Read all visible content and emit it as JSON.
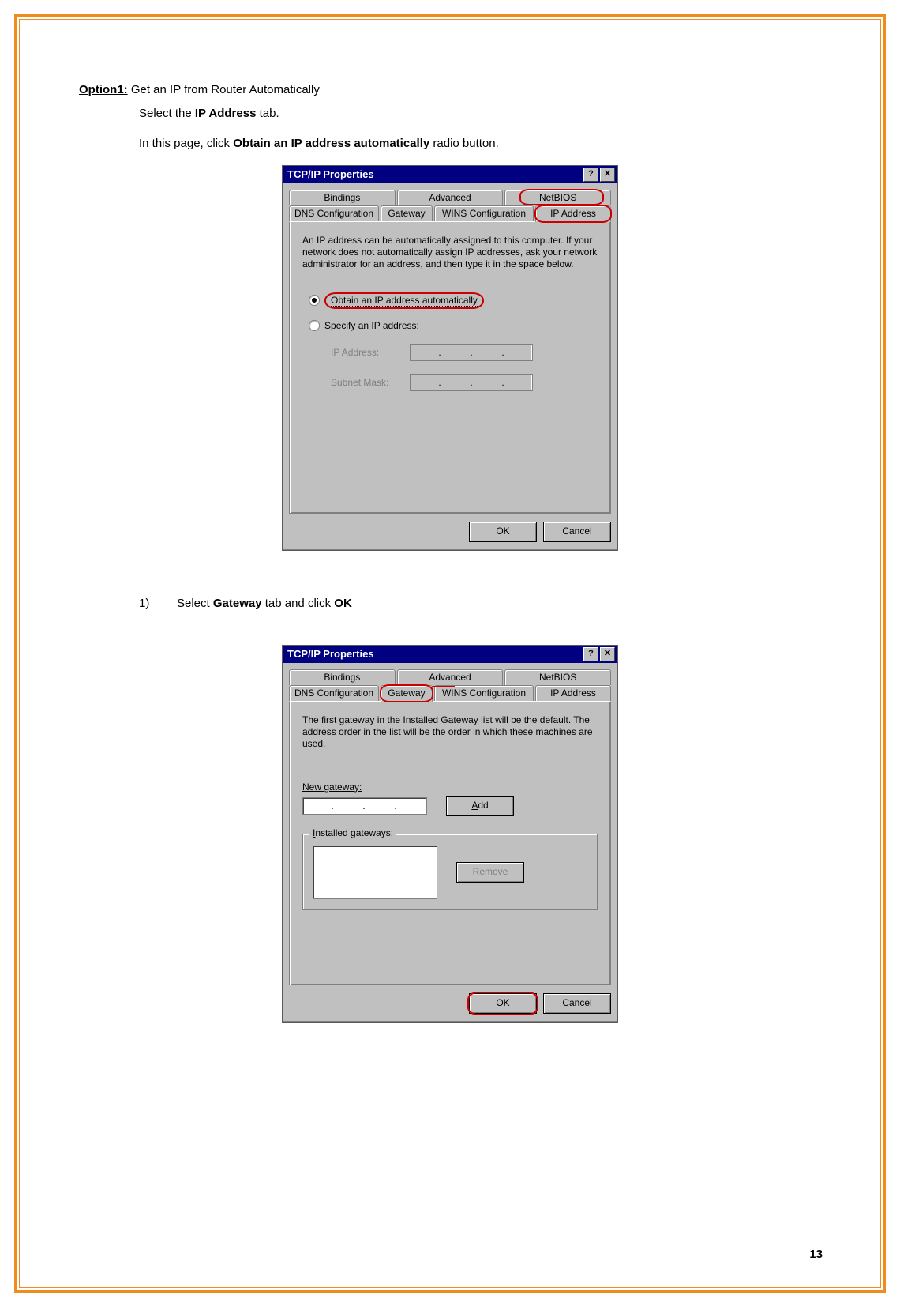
{
  "doc": {
    "option_label": "Option1:",
    "option_text": " Get an IP from Router Automatically",
    "line2a": "Select the ",
    "line2b": "IP Address",
    "line2c": " tab.",
    "line3a": "In this page, click ",
    "line3b": "Obtain an IP address automatically",
    "line3c": " radio button.",
    "step_num": "1)",
    "step_text_a": "Select ",
    "step_text_b": "Gateway",
    "step_text_c": " tab and click ",
    "step_text_d": "OK",
    "page_number": "13"
  },
  "dialog1": {
    "title": "TCP/IP Properties",
    "help": "?",
    "close": "✕",
    "tabs_row1": {
      "bindings": "Bindings",
      "advanced": "Advanced",
      "netbios": "NetBIOS"
    },
    "tabs_row2": {
      "dns": "DNS Configuration",
      "gateway": "Gateway",
      "wins": "WINS Configuration",
      "ip": "IP Address"
    },
    "desc": "An IP address can be automatically assigned to this computer. If your network does not automatically assign IP addresses, ask your network administrator for an address, and then type it in the space below.",
    "radio_auto": "Obtain an IP address automatically",
    "radio_specify": "Specify an IP address:",
    "ip_label": "IP Address:",
    "subnet_label": "Subnet Mask:",
    "ok": "OK",
    "cancel": "Cancel"
  },
  "dialog2": {
    "title": "TCP/IP Properties",
    "help": "?",
    "close": "✕",
    "tabs_row1": {
      "bindings": "Bindings",
      "advanced": "Advanced",
      "netbios": "NetBIOS"
    },
    "tabs_row2": {
      "dns": "DNS Configuration",
      "gateway": "Gateway",
      "wins": "WINS Configuration",
      "ip": "IP Address"
    },
    "desc": "The first gateway in the Installed Gateway list will be the default. The address order in the list will be the order in which these machines are used.",
    "new_gateway": "New gateway:",
    "add": "Add",
    "installed": "Installed gateways:",
    "remove": "Remove",
    "ok": "OK",
    "cancel": "Cancel"
  }
}
